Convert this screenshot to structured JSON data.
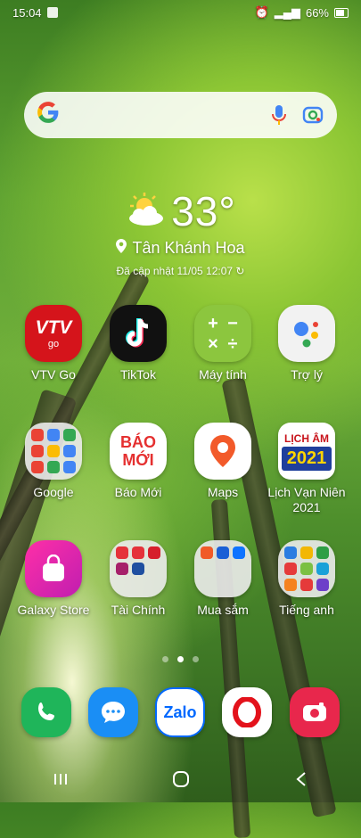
{
  "status": {
    "time": "15:04",
    "battery": "66%"
  },
  "search": {
    "engine_icon": "google-g-icon",
    "mic_icon": "mic-icon",
    "lens_icon": "lens-icon"
  },
  "weather": {
    "temp": "33°",
    "location": "Tân Khánh Hoa",
    "updated": "Đã cập nhật 11/05 12:07"
  },
  "apps": [
    {
      "label": "VTV Go"
    },
    {
      "label": "TikTok"
    },
    {
      "label": "Máy tính"
    },
    {
      "label": "Trợ lý"
    },
    {
      "label": "Google"
    },
    {
      "label": "Báo Mới"
    },
    {
      "label": "Maps"
    },
    {
      "label": "Lịch Vạn Niên 2021"
    },
    {
      "label": "Galaxy Store"
    },
    {
      "label": "Tài Chính"
    },
    {
      "label": "Mua sắm"
    },
    {
      "label": "Tiếng anh"
    }
  ],
  "icon_text": {
    "vtv": "VTV",
    "vtv_sub": "go",
    "baomoi_1": "BÁO",
    "baomoi_2": "MỚI",
    "lich_1": "LỊCH ÂM",
    "lich_2": "2021",
    "zalo": "Zalo"
  },
  "page_indicator": {
    "count": 3,
    "active": 1
  },
  "dock": [
    {
      "name": "phone"
    },
    {
      "name": "messages"
    },
    {
      "name": "zalo"
    },
    {
      "name": "opera"
    },
    {
      "name": "camera"
    }
  ]
}
